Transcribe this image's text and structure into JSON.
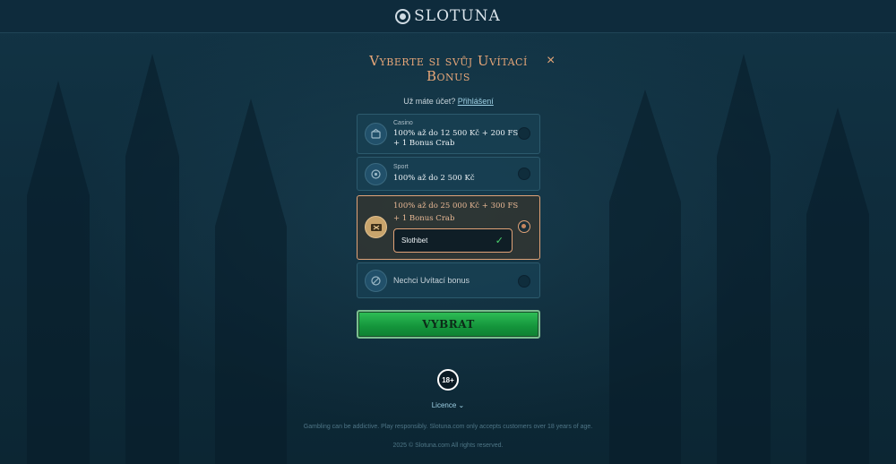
{
  "header": {
    "logo_text": "SLOTUNA"
  },
  "modal": {
    "title": "Vyberte si svůj Uvítací Bonus",
    "close_icon": "×",
    "login_prompt": "Už máte účet?",
    "login_link": "Přihlášení"
  },
  "options": [
    {
      "icon": "casino-icon",
      "label": "Casino",
      "text_line1": "100% až do 12 500 Kč + 200 FS",
      "text_line2": "+ 1 Bonus Crab",
      "selected": false
    },
    {
      "icon": "sport-icon",
      "label": "Sport",
      "text_line1": "100% až do 2 500 Kč",
      "selected": false
    },
    {
      "icon": "ticket-icon",
      "text_line1": "100% až do 25 000 Kč + 300 FS",
      "text_line2": "+ 1 Bonus Crab",
      "promo_code": "Slothbet",
      "selected": true
    },
    {
      "icon": "no-bonus-icon",
      "text_line1": "Nechci Uvítací bonus",
      "selected": false
    }
  ],
  "submit_label": "VYBRAT",
  "footer": {
    "age_badge": "18+",
    "licence_label": "Licence",
    "disclaimer": "Gambling can be addictive. Play responsibly. Slotuna.com only accepts customers over 18 years of age.",
    "copyright": "2025 © Slotuna.com All rights reserved."
  },
  "colors": {
    "accent": "#e1a277",
    "submit_green": "#1fa647",
    "link": "#9ed0e4",
    "background": "#0e2a3a"
  }
}
